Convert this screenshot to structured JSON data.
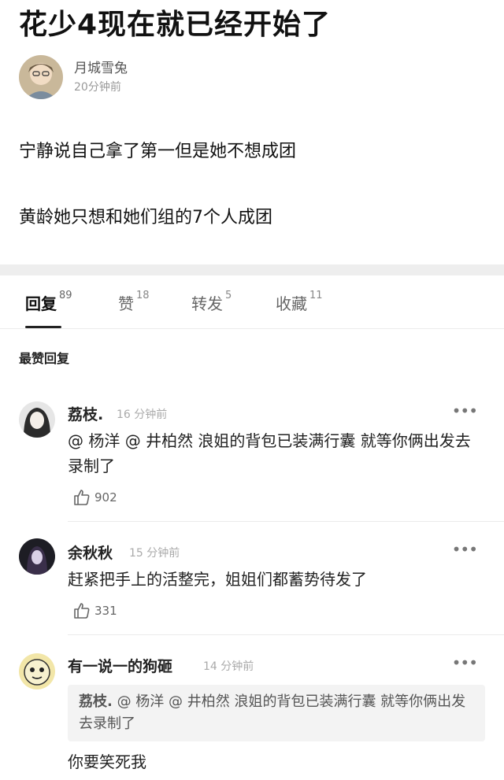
{
  "post": {
    "title": "花少4现在就已经开始了",
    "author_name": "月城雪兔",
    "time": "20分钟前",
    "paragraphs": [
      "宁静说自己拿了第一但是她不想成团",
      "黄龄她只想和她们组的7个人成团"
    ]
  },
  "tabs": [
    {
      "label": "回复",
      "count": "89"
    },
    {
      "label": "赞",
      "count": "18"
    },
    {
      "label": "转发",
      "count": "5"
    },
    {
      "label": "收藏",
      "count": "11"
    }
  ],
  "section_title": "最赞回复",
  "comments": [
    {
      "name": "荔枝.",
      "time": "16 分钟前",
      "text": "@ 杨洋 @ 井柏然 浪姐的背包已装满行囊 就等你俩出发去录制了",
      "likes": "902"
    },
    {
      "name": "余秋秋",
      "time": "15 分钟前",
      "text": "赶紧把手上的活整完，姐姐们都蓄势待发了",
      "likes": "331"
    },
    {
      "name": "有一说一的狗砸",
      "time": "14 分钟前",
      "quote_author": "荔枝.",
      "quote_text": " @ 杨洋 @ 井柏然 浪姐的背包已装满行囊 就等你俩出发去录制了",
      "text": "你要笑死我"
    }
  ],
  "more_label": "•••",
  "colors": {
    "accent": "#222222",
    "divider": "#eeeeee"
  }
}
